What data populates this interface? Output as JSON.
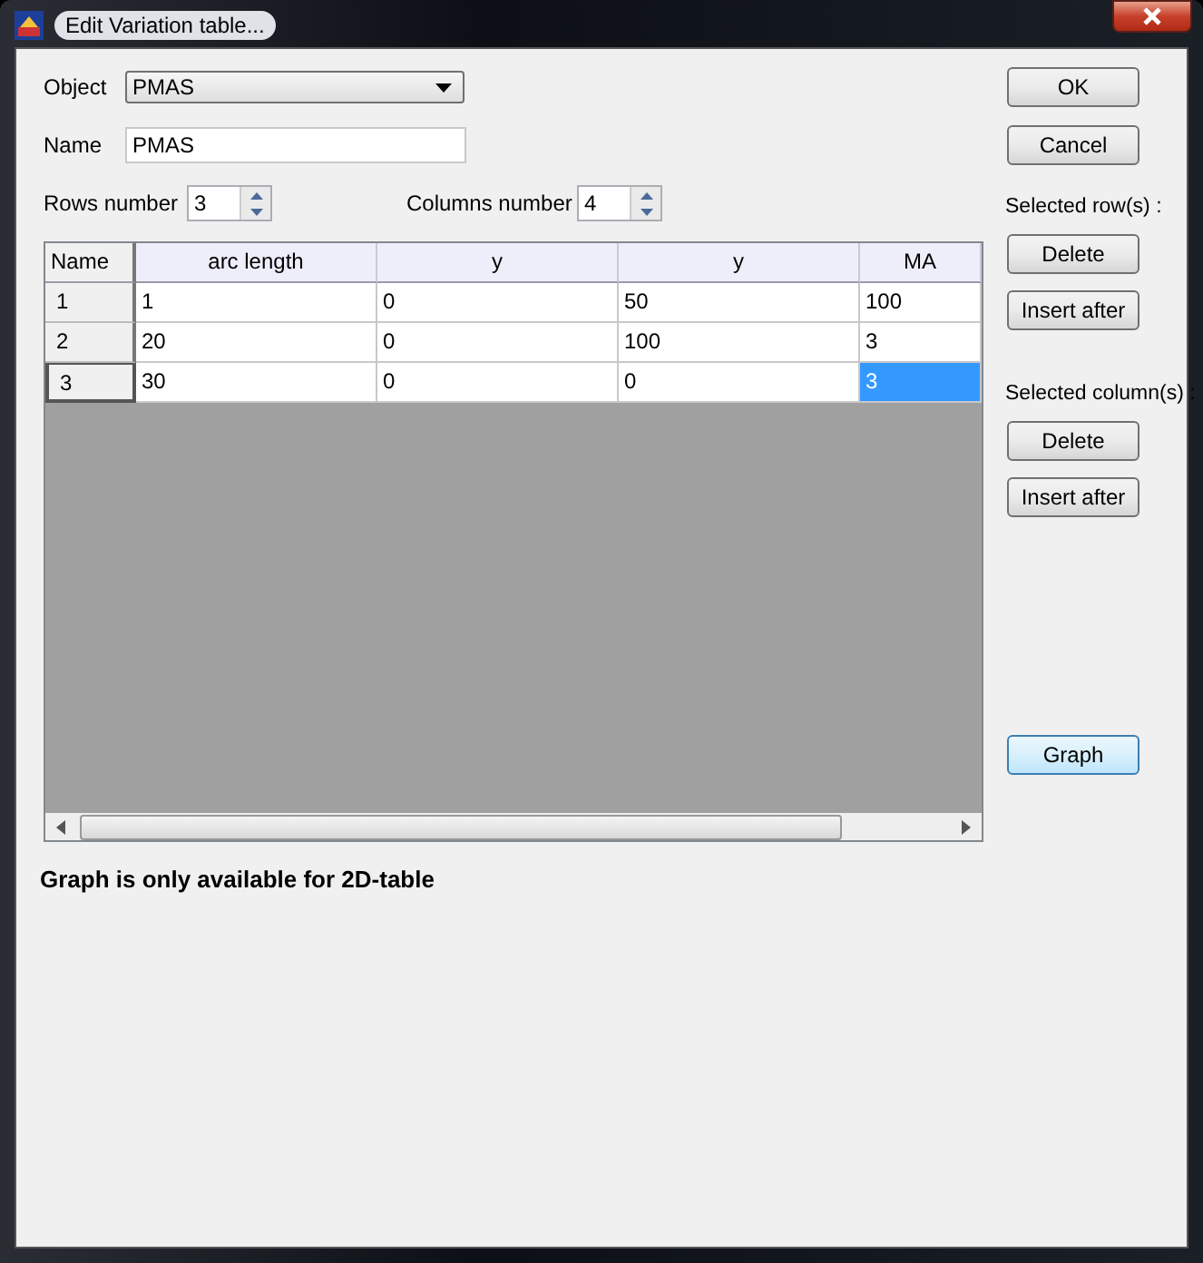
{
  "window": {
    "title": "Edit Variation table..."
  },
  "object": {
    "label": "Object",
    "value": "PMAS"
  },
  "name": {
    "label": "Name",
    "value": "PMAS"
  },
  "rows_number": {
    "label": "Rows number",
    "value": "3"
  },
  "columns_number": {
    "label": "Columns number",
    "value": "4"
  },
  "table": {
    "columns": [
      "Name",
      "arc length",
      "y",
      "y",
      "MA"
    ],
    "rows": [
      {
        "name": "1",
        "cells": [
          {
            "text": "1",
            "selected": false
          },
          {
            "text": "0",
            "selected": false
          },
          {
            "text": "50",
            "selected": false
          },
          {
            "text": "100",
            "selected": false
          }
        ]
      },
      {
        "name": "2",
        "cells": [
          {
            "text": "20",
            "selected": false
          },
          {
            "text": "0",
            "selected": false
          },
          {
            "text": "100",
            "selected": false
          },
          {
            "text": "3",
            "selected": false
          }
        ]
      },
      {
        "name": "3",
        "cells": [
          {
            "text": "30",
            "selected": false
          },
          {
            "text": "0",
            "selected": false
          },
          {
            "text": "0",
            "selected": false
          },
          {
            "text": "3",
            "selected": true
          }
        ]
      }
    ]
  },
  "note": "Graph is only available for 2D-table",
  "buttons": {
    "ok": "OK",
    "cancel": "Cancel",
    "rows_label": "Selected row(s) :",
    "row_delete": "Delete",
    "row_insert": "Insert after",
    "cols_label": "Selected column(s) :",
    "col_delete": "Delete",
    "col_insert": "Insert after",
    "graph": "Graph"
  }
}
